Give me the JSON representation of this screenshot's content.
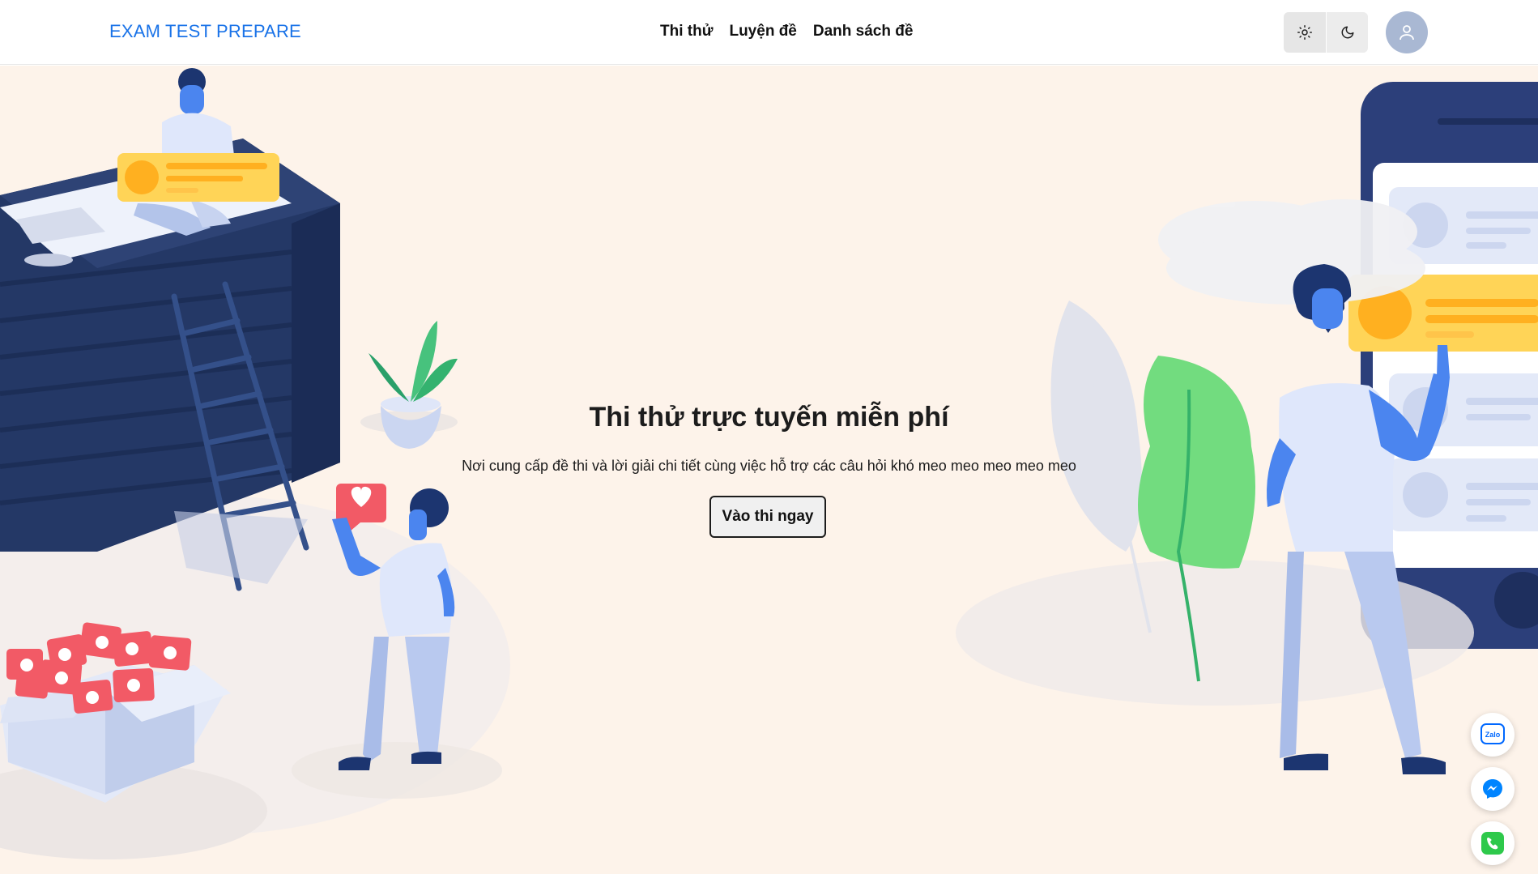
{
  "header": {
    "brand": "EXAM TEST PREPARE",
    "nav": [
      "Thi thử",
      "Luyện đề",
      "Danh sách đề"
    ],
    "theme_light_icon": "sun-icon",
    "theme_dark_icon": "moon-icon",
    "avatar_icon": "user-icon"
  },
  "hero": {
    "title": "Thi thử trực tuyến miễn phí",
    "subtitle": "Nơi cung cấp đề thi và lời giải chi tiết cùng việc hỗ trợ các câu hỏi khó meo meo meo meo meo",
    "cta_label": "Vào thi ngay",
    "background": "#fdf3ea"
  },
  "floating_contacts": [
    {
      "name": "zalo",
      "label": "Zalo",
      "icon": "zalo-icon",
      "color": "#0068ff"
    },
    {
      "name": "messenger",
      "icon": "messenger-icon",
      "color": "#0084ff"
    },
    {
      "name": "phone",
      "icon": "phone-icon",
      "color": "#2ec94b"
    }
  ],
  "colors": {
    "brand": "#1a73e8",
    "navy": "#1e3160",
    "accent_yellow": "#ffcc40",
    "accent_red": "#f25a66"
  }
}
